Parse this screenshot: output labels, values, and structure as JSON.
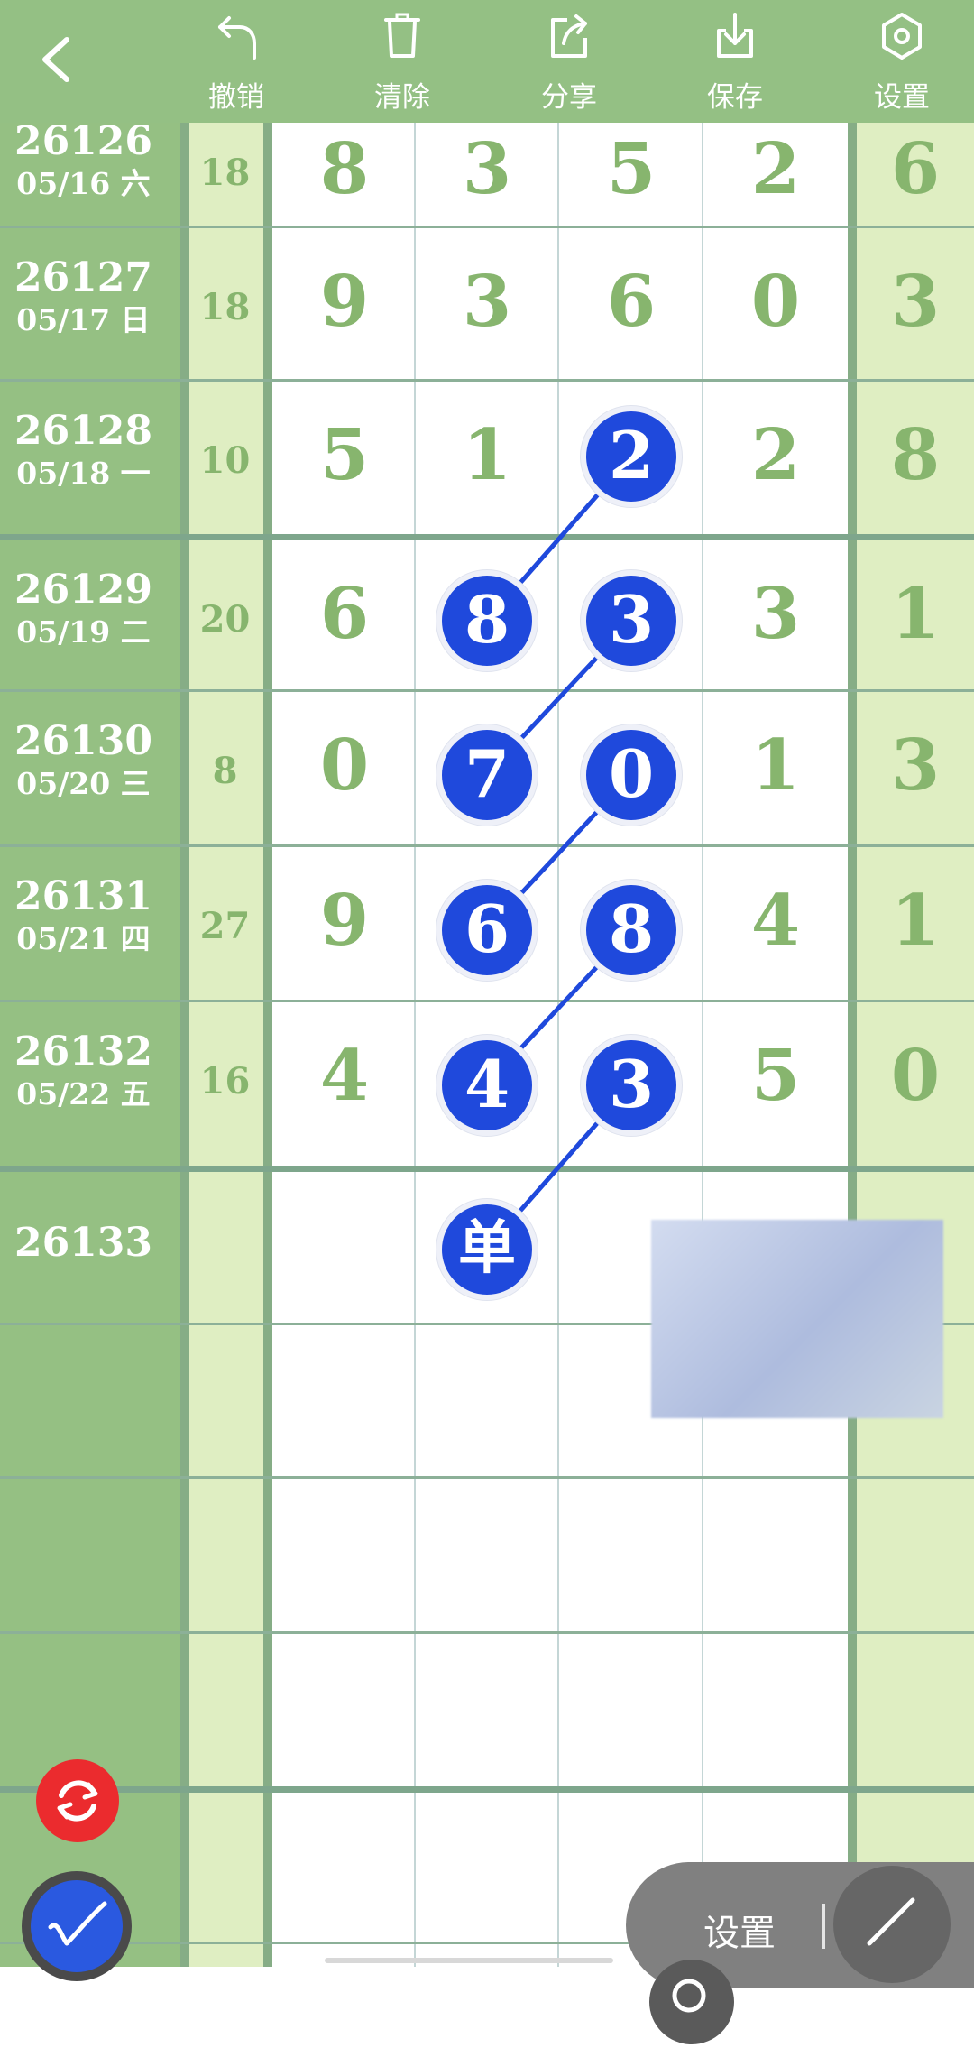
{
  "toolbar": {
    "back_icon": "chevron-left-icon",
    "undo_label": "撤销",
    "clear_label": "清除",
    "share_label": "分享",
    "save_label": "保存",
    "settings_label": "设置"
  },
  "rows": [
    {
      "period": "26126",
      "date": "05/16 六",
      "sum": "18",
      "digits": [
        "8",
        "3",
        "5",
        "2"
      ],
      "extra": "6"
    },
    {
      "period": "26127",
      "date": "05/17 日",
      "sum": "18",
      "digits": [
        "9",
        "3",
        "6",
        "0"
      ],
      "extra": "3"
    },
    {
      "period": "26128",
      "date": "05/18 一",
      "sum": "10",
      "digits": [
        "5",
        "1",
        "2",
        "2"
      ],
      "extra": "8"
    },
    {
      "period": "26129",
      "date": "05/19 二",
      "sum": "20",
      "digits": [
        "6",
        "8",
        "3",
        "3"
      ],
      "extra": "1"
    },
    {
      "period": "26130",
      "date": "05/20 三",
      "sum": "8",
      "digits": [
        "0",
        "7",
        "0",
        "1"
      ],
      "extra": "3"
    },
    {
      "period": "26131",
      "date": "05/21 四",
      "sum": "27",
      "digits": [
        "9",
        "6",
        "8",
        "4"
      ],
      "extra": "1"
    },
    {
      "period": "26132",
      "date": "05/22 五",
      "sum": "16",
      "digits": [
        "4",
        "4",
        "3",
        "5"
      ],
      "extra": "0"
    },
    {
      "period": "26133",
      "date": "",
      "sum": "",
      "digits": [
        "",
        "",
        "",
        ""
      ],
      "extra": ""
    }
  ],
  "marks": {
    "odd_label": "单"
  },
  "bottom": {
    "settings_label": "设置",
    "sync_icon": "sync-icon",
    "pen_icon": "pen-icon",
    "line_icon": "line-tool-icon"
  },
  "colors": {
    "toolbar": "#94c084",
    "ball": "#1f49dc",
    "digit": "#87b56e",
    "sync_button": "#eb2b2e"
  }
}
